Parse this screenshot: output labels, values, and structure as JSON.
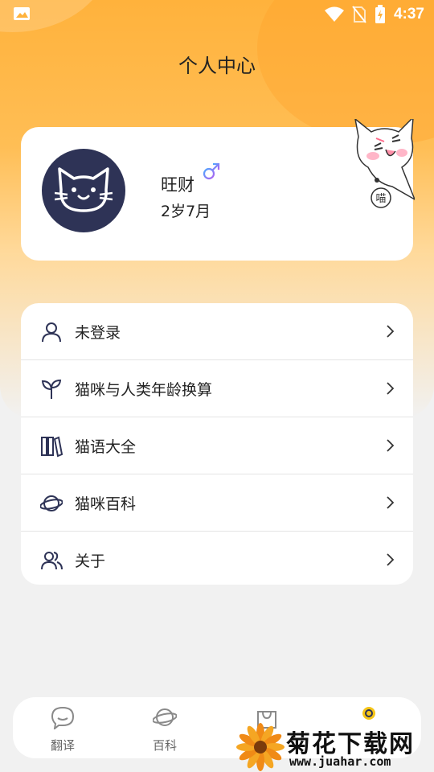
{
  "status_bar": {
    "time": "4:37"
  },
  "header": {
    "title": "个人中心"
  },
  "profile": {
    "name": "旺财",
    "age": "2岁7月",
    "sticker_text": "喵",
    "gender_icon": "male-symbol-icon"
  },
  "menu": {
    "items": [
      {
        "label": "未登录",
        "icon": "user-icon"
      },
      {
        "label": "猫咪与人类年龄换算",
        "icon": "sprout-icon"
      },
      {
        "label": "猫语大全",
        "icon": "books-icon"
      },
      {
        "label": "猫咪百科",
        "icon": "planet-icon"
      },
      {
        "label": "关于",
        "icon": "users-icon"
      }
    ]
  },
  "tabbar": {
    "tabs": [
      {
        "label": "翻译",
        "icon": "chat-bubble-icon"
      },
      {
        "label": "百科",
        "icon": "planet-icon"
      },
      {
        "label": "",
        "icon": "bag-icon"
      },
      {
        "label": "",
        "icon": "profile-icon",
        "active": true
      }
    ]
  },
  "watermark": {
    "title": "菊花下载网",
    "url": "www.juahar.com"
  },
  "colors": {
    "accent": "#ffb23c",
    "avatar_bg": "#2e3356",
    "gender": "#7b6cf6",
    "active_tab": "#f5c518"
  }
}
